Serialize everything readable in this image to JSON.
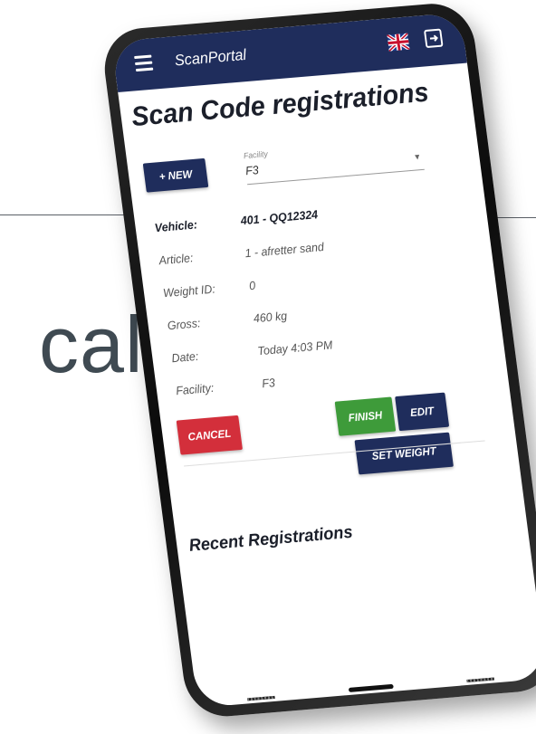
{
  "background": {
    "word": "cal"
  },
  "app": {
    "title": "ScanPortal",
    "language_flag": "uk-flag-icon",
    "exit_icon": "exit-icon"
  },
  "page": {
    "title": "Scan Code registrations"
  },
  "toolbar": {
    "new_label": "+ NEW"
  },
  "facility": {
    "label": "Facility",
    "value": "F3"
  },
  "details": [
    {
      "label": "Vehicle:",
      "value": "401 - QQ12324"
    },
    {
      "label": "Article:",
      "value": "1 - afretter sand"
    },
    {
      "label": "Weight ID:",
      "value": "0"
    },
    {
      "label": "Gross:",
      "value": "460 kg"
    },
    {
      "label": "Date:",
      "value": "Today 4:03 PM"
    },
    {
      "label": "Facility:",
      "value": "F3"
    }
  ],
  "actions": {
    "cancel": "CANCEL",
    "finish": "FINISH",
    "edit": "EDIT",
    "set_weight": "SET WEIGHT"
  },
  "recent": {
    "title": "Recent Registrations"
  },
  "colors": {
    "appbar": "#1f2d5c",
    "primary": "#1f2d5c",
    "cancel": "#d32f3b",
    "finish": "#3e9b3a"
  }
}
